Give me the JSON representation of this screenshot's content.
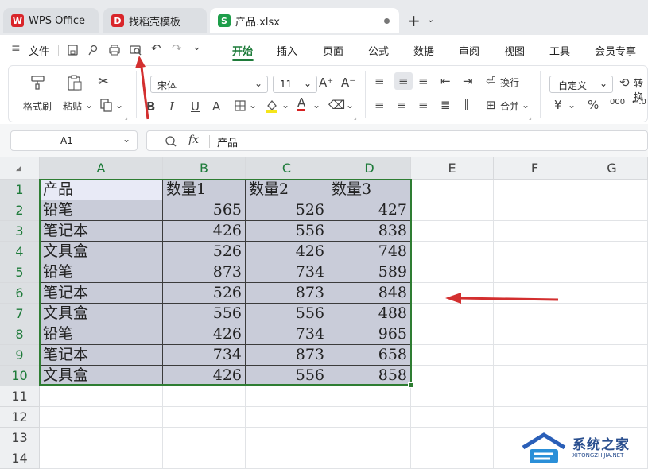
{
  "tabs": {
    "wps": {
      "label": "WPS Office",
      "color": "#d9252a"
    },
    "template": {
      "label": "找稻壳模板",
      "color": "#d9252a"
    },
    "file": {
      "label": "产品.xlsx",
      "logo": "S",
      "color": "#1e9e4a"
    },
    "new_tab": "+"
  },
  "menu": {
    "file_label": "文件",
    "items": [
      "开始",
      "插入",
      "页面",
      "公式",
      "数据",
      "审阅",
      "视图",
      "工具",
      "会员专享"
    ],
    "active": "开始"
  },
  "ribbon": {
    "format_painter": "格式刷",
    "paste": "粘贴",
    "font_name": "宋体",
    "font_size": "11",
    "bold": "B",
    "italic": "I",
    "underline": "U",
    "strike": "A",
    "wrap": "换行",
    "merge": "合并",
    "number_format": "自定义",
    "convert": "转换",
    "currency": "¥",
    "percent": "%"
  },
  "formula_bar": {
    "name_box": "A1",
    "fx": "fx",
    "value": "产品"
  },
  "sheet": {
    "columns": [
      "A",
      "B",
      "C",
      "D",
      "E",
      "F",
      "G"
    ],
    "rows": [
      "1",
      "2",
      "3",
      "4",
      "5",
      "6",
      "7",
      "8",
      "9",
      "10",
      "11",
      "12",
      "13",
      "14"
    ],
    "header": [
      "产品",
      "数量1",
      "数量2",
      "数量3"
    ],
    "data": [
      [
        "铅笔",
        "565",
        "526",
        "427"
      ],
      [
        "笔记本",
        "426",
        "556",
        "838"
      ],
      [
        "文具盒",
        "526",
        "426",
        "748"
      ],
      [
        "铅笔",
        "873",
        "734",
        "589"
      ],
      [
        "笔记本",
        "526",
        "873",
        "848"
      ],
      [
        "文具盒",
        "556",
        "556",
        "488"
      ],
      [
        "铅笔",
        "426",
        "734",
        "965"
      ],
      [
        "笔记本",
        "734",
        "873",
        "658"
      ],
      [
        "文具盒",
        "426",
        "556",
        "858"
      ]
    ]
  },
  "watermark": {
    "title": "系统之家",
    "url": "XITONGZHIJIA.NET"
  },
  "colors": {
    "accent": "#1e7b3a",
    "selection_border": "#2e7d32",
    "annotation_arrow": "#d32f2f"
  }
}
